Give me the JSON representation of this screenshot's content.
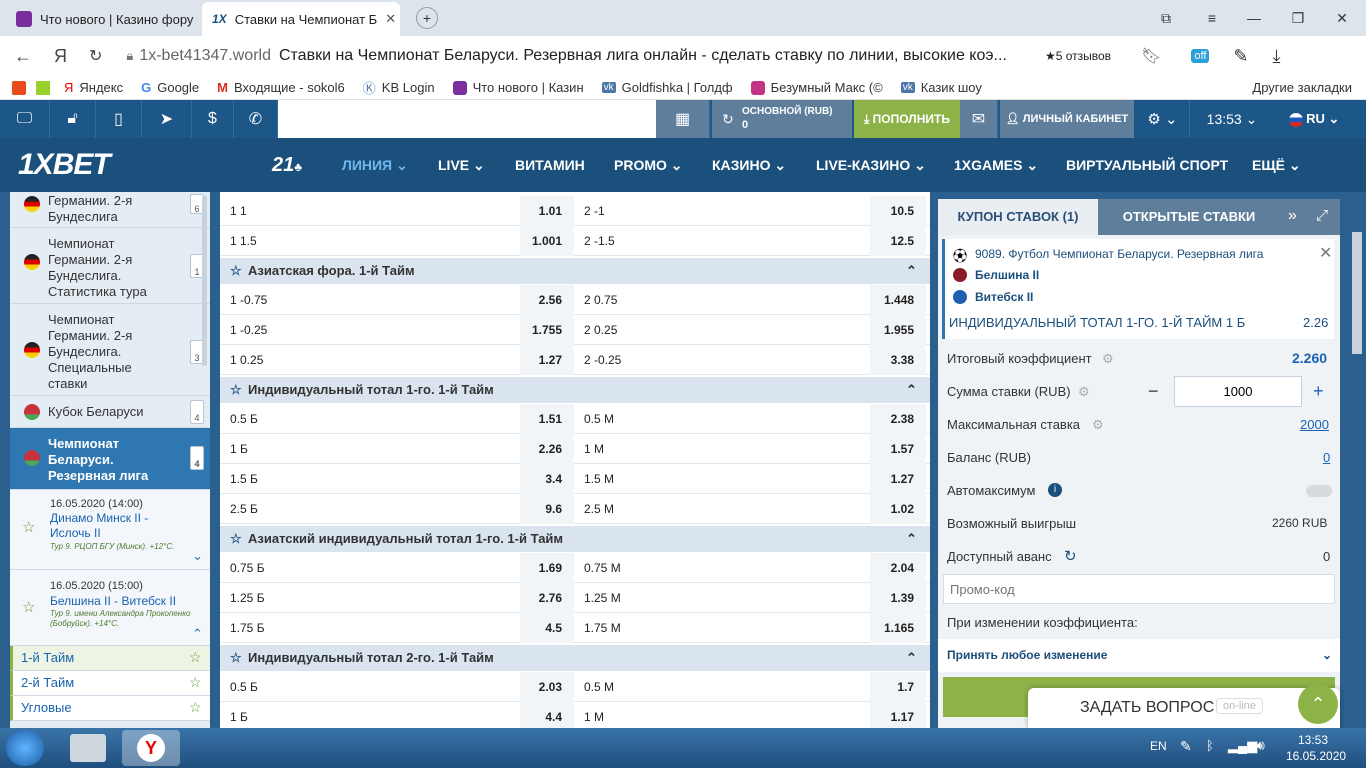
{
  "browser": {
    "tabs": [
      {
        "title": "Что нового | Казино фору"
      },
      {
        "title": "Ставки на Чемпионат Б"
      }
    ],
    "url": "1x-bet41347.world",
    "page_title": "Ставки на Чемпионат Беларуси. Резервная лига онлайн - сделать ставку по линии, высокие коэ...",
    "reviews": "★5 отзывов",
    "bookmarks": [
      "Яндекс",
      "Google",
      "Входящие - sokol6",
      "KB Login",
      "Что нового | Казин",
      "Goldfishka | Голдф",
      "Безумный Макс (©",
      "Казик шоу"
    ],
    "other_bookmarks": "Другие закладки"
  },
  "colors": {
    "accent": "#1b4f7c",
    "top": "#1d5788",
    "green": "#8db348",
    "gray_btn": "#5f7e9c"
  },
  "site": {
    "balance_label": "ОСНОВНОЙ (RUB)",
    "balance_value": "0",
    "deposit": "ПОПОЛНИТЬ",
    "cabinet": "ЛИЧНЫЙ КАБИНЕТ",
    "time": "13:53",
    "lang": "RU",
    "logo": "1XBET",
    "nav": [
      "21",
      "ЛИНИЯ",
      "LIVE",
      "ВИТАМИН",
      "PROMO",
      "КАЗИНО",
      "LIVE-КАЗИНО",
      "1XGAMES",
      "ВИРТУАЛЬНЫЙ СПОРТ",
      "ЕЩЁ"
    ]
  },
  "sidebar": {
    "leagues": [
      {
        "name": "Германии. 2-я Бундеслига",
        "count": "6"
      },
      {
        "name": "Чемпионат Германии. 2-я Бундеслига. Статистика тура",
        "count": "1"
      },
      {
        "name": "Чемпионат Германии. 2-я Бундеслига. Специальные ставки",
        "count": "3"
      },
      {
        "name": "Кубок Беларуси",
        "count": "4"
      },
      {
        "name": "Чемпионат Беларуси. Резервная лига",
        "count": "4"
      }
    ],
    "matches": [
      {
        "date": "16.05.2020 (14:00)",
        "teams": "Динамо Минск II - Ислочь II",
        "info": "Тур 9. РЦОП БГУ (Минск). +12°C."
      },
      {
        "date": "16.05.2020 (15:00)",
        "teams": "Белшина II - Витебск II",
        "info": "Тур 9. имени Александра Прокопенко (Бобруйск). +14°C."
      }
    ],
    "periods": [
      "1-й Тайм",
      "2-й Тайм",
      "Угловые"
    ]
  },
  "markets": [
    {
      "title": "",
      "rows": [
        [
          "1 1",
          "1.01",
          "2 -1",
          "10.5"
        ],
        [
          "1 1.5",
          "1.001",
          "2 -1.5",
          "12.5"
        ]
      ]
    },
    {
      "title": "Азиатская фора. 1-й Тайм",
      "rows": [
        [
          "1 -0.75",
          "2.56",
          "2 0.75",
          "1.448"
        ],
        [
          "1 -0.25",
          "1.755",
          "2 0.25",
          "1.955"
        ],
        [
          "1 0.25",
          "1.27",
          "2 -0.25",
          "3.38"
        ]
      ]
    },
    {
      "title": "Индивидуальный тотал 1-го. 1-й Тайм",
      "rows": [
        [
          "0.5 Б",
          "1.51",
          "0.5 М",
          "2.38"
        ],
        [
          "1 Б",
          "2.26",
          "1 М",
          "1.57"
        ],
        [
          "1.5 Б",
          "3.4",
          "1.5 М",
          "1.27"
        ],
        [
          "2.5 Б",
          "9.6",
          "2.5 М",
          "1.02"
        ]
      ]
    },
    {
      "title": "Азиатский индивидуальный тотал 1-го. 1-й Тайм",
      "rows": [
        [
          "0.75 Б",
          "1.69",
          "0.75 М",
          "2.04"
        ],
        [
          "1.25 Б",
          "2.76",
          "1.25 М",
          "1.39"
        ],
        [
          "1.75 Б",
          "4.5",
          "1.75 М",
          "1.165"
        ]
      ]
    },
    {
      "title": "Индивидуальный тотал 2-го. 1-й Тайм",
      "rows": [
        [
          "0.5 Б",
          "2.03",
          "0.5 М",
          "1.7"
        ],
        [
          "1 Б",
          "4.4",
          "1 М",
          "1.17"
        ]
      ]
    }
  ],
  "coupon": {
    "tab_active": "КУПОН СТАВОК (1)",
    "tab_other": "ОТКРЫТЫЕ СТАВКИ",
    "event": "9089. Футбол Чемпионат Беларуси. Резервная лига",
    "team1": "Белшина II",
    "team2": "Витебск II",
    "bet": "ИНДИВИДУАЛЬНЫЙ ТОТАЛ 1-ГО. 1-Й ТАЙМ 1 Б",
    "bet_odds": "2.26",
    "total_coef_label": "Итоговый коэффициент",
    "total_coef": "2.260",
    "stake_label": "Сумма ставки (RUB)",
    "stake": "1000",
    "max_label": "Максимальная ставка",
    "max": "2000",
    "balance_label": "Баланс (RUB)",
    "balance": "0",
    "auto_label": "Автомаксимум",
    "win_label": "Возможный выигрыш",
    "win": "2260 RUB",
    "advance_label": "Доступный аванс",
    "advance": "0",
    "promo_placeholder": "Промо-код",
    "change_label": "При изменении коэффициента:",
    "change_value": "Принять любое изменение"
  },
  "chat": {
    "label": "ЗАДАТЬ ВОПРОС",
    "status": "on-line"
  },
  "taskbar": {
    "lang": "EN",
    "time": "13:53",
    "date": "16.05.2020"
  }
}
